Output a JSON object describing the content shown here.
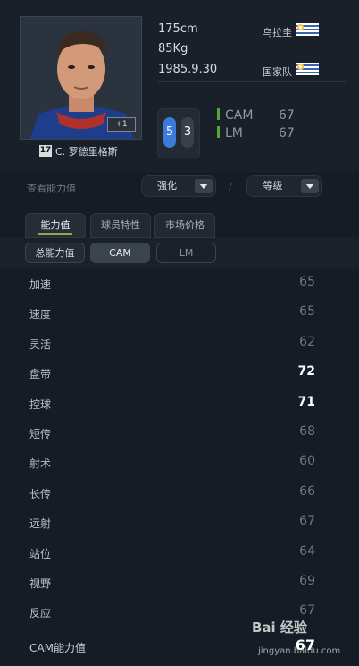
{
  "player": {
    "name": "C. 罗德里格斯",
    "season_badge": "17",
    "plus_badge": "+1",
    "height": "175cm",
    "weight": "85Kg",
    "birthdate": "1985.9.30",
    "nationality_label": "乌拉圭",
    "national_team_label": "国家队"
  },
  "foot": {
    "left": "5",
    "right": "3"
  },
  "positions": [
    {
      "name": "CAM",
      "rating": "67"
    },
    {
      "name": "LM",
      "rating": "67"
    }
  ],
  "controls": {
    "view_label": "查看能力值",
    "enhance_label": "强化",
    "divider": "/",
    "level_label": "等级"
  },
  "tabs": [
    {
      "label": "能力值",
      "active": true
    },
    {
      "label": "球员特性",
      "active": false
    },
    {
      "label": "市场价格",
      "active": false
    }
  ],
  "subtabs": [
    {
      "label": "总能力值"
    },
    {
      "label": "CAM"
    },
    {
      "label": "LM"
    }
  ],
  "stats": [
    {
      "label": "加速",
      "value": "65",
      "highlight": false
    },
    {
      "label": "速度",
      "value": "65",
      "highlight": false
    },
    {
      "label": "灵活",
      "value": "62",
      "highlight": false
    },
    {
      "label": "盘带",
      "value": "72",
      "highlight": true
    },
    {
      "label": "控球",
      "value": "71",
      "highlight": true
    },
    {
      "label": "短传",
      "value": "68",
      "highlight": false
    },
    {
      "label": "射术",
      "value": "60",
      "highlight": false
    },
    {
      "label": "长传",
      "value": "66",
      "highlight": false
    },
    {
      "label": "远射",
      "value": "67",
      "highlight": false
    },
    {
      "label": "站位",
      "value": "64",
      "highlight": false
    },
    {
      "label": "视野",
      "value": "69",
      "highlight": false
    },
    {
      "label": "反应",
      "value": "67",
      "highlight": false
    }
  ],
  "summary": {
    "label": "CAM能力值",
    "value": "67"
  },
  "watermark": {
    "text": "Bai 经验",
    "sub": "jingyan.baidu.com"
  },
  "colors": {
    "accent_green": "#4caa3c",
    "foot_blue": "#3b7ad9",
    "background": "#161c25"
  }
}
